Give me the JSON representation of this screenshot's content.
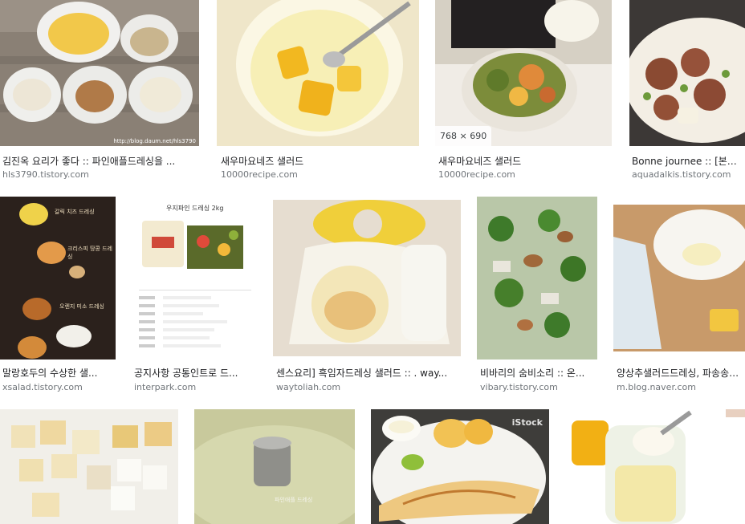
{
  "results": [
    {
      "title": "김진옥 요리가 좋다 :: 파인애플드레싱을 ...",
      "source": "hls3790.tistory.com",
      "watermark": "http://blog.daum.net/hls3790"
    },
    {
      "title": "새우마요네즈 샐러드",
      "source": "10000recipe.com"
    },
    {
      "title": "새우마요네즈 샐러드",
      "source": "10000recipe.com",
      "size_label": "768 × 690"
    },
    {
      "title": "Bonne journee :: [본문...",
      "source": "aquadalkis.tistory.com"
    },
    {
      "title": "말랑호두의 수상한 샐...",
      "source": "xsalad.tistory.com",
      "labels": [
        "갈릭 치즈 드레싱",
        "크리스피 땅콩 드레싱",
        "오렌지 미소 드레싱"
      ]
    },
    {
      "title": "공지사항 공통인트로 드...",
      "source": "interpark.com",
      "product_name": "우지파인 드레싱 2kg"
    },
    {
      "title": "센스요리] 흑임자드레싱 샐러드 :: . way...",
      "source": "waytoliah.com"
    },
    {
      "title": "비바리의 숨비소리 :: 온...",
      "source": "vibary.tistory.com"
    },
    {
      "title": "양상추샐러드드레싱, 파송송오...",
      "source": "m.blog.naver.com"
    },
    {
      "title": "",
      "source": ""
    },
    {
      "title": "",
      "source": "",
      "watermark": "파인애플 드레싱"
    },
    {
      "title": "",
      "source": "",
      "watermark": "iStock"
    },
    {
      "title": "",
      "source": ""
    }
  ]
}
